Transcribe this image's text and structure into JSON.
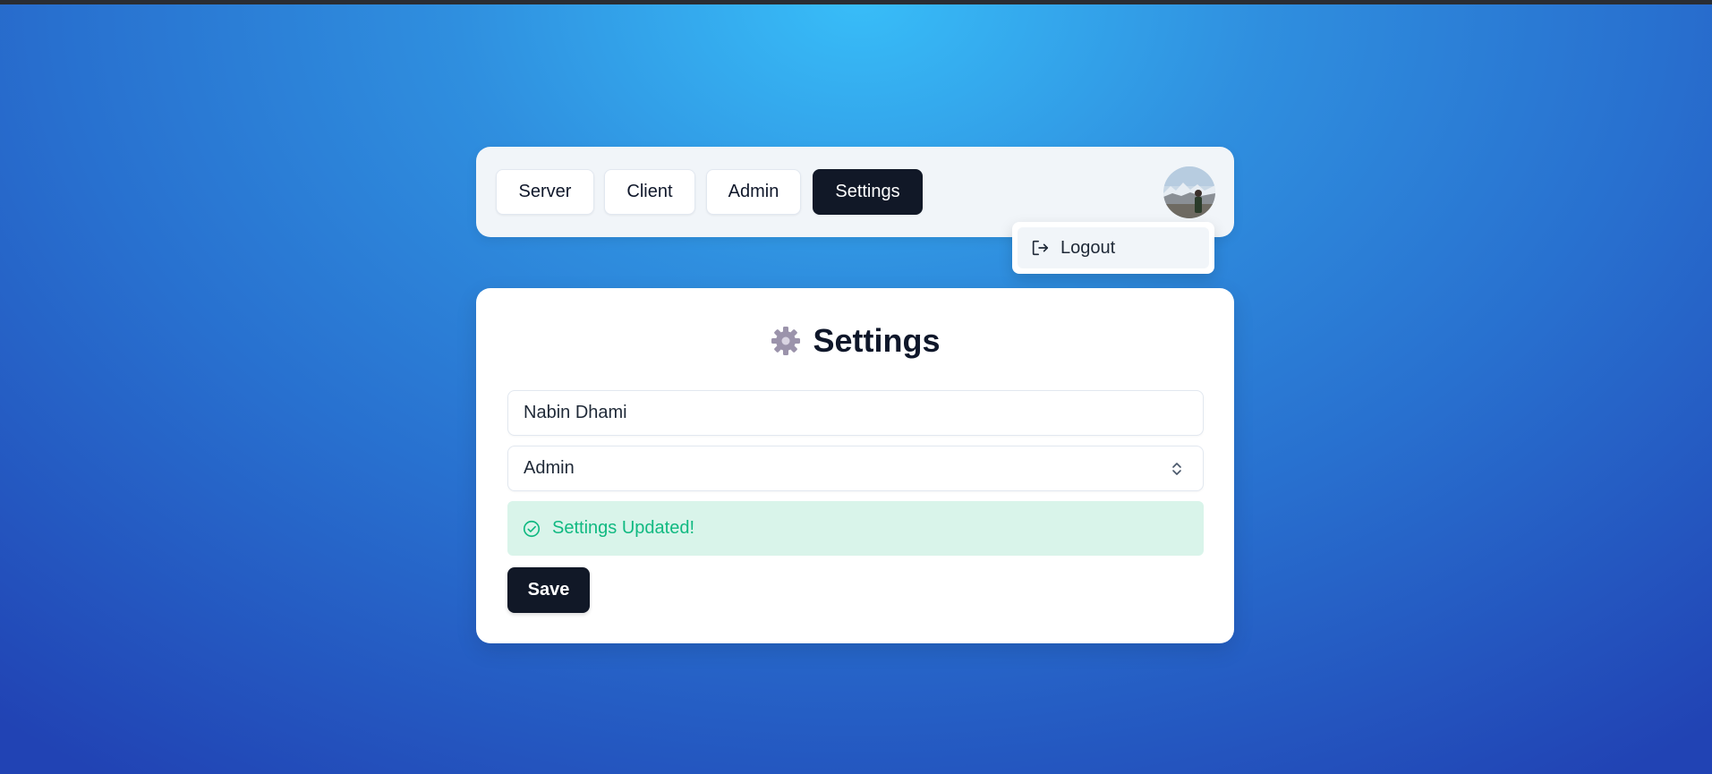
{
  "nav": {
    "items": [
      {
        "label": "Server",
        "active": false
      },
      {
        "label": "Client",
        "active": false
      },
      {
        "label": "Admin",
        "active": false
      },
      {
        "label": "Settings",
        "active": true
      }
    ],
    "avatar_alt": "User avatar"
  },
  "dropdown": {
    "logout_label": "Logout",
    "logout_icon": "logout-icon"
  },
  "settings": {
    "title": "Settings",
    "title_icon": "gear-icon",
    "name_value": "Nabin Dhami",
    "role_value": "Admin",
    "alert_text": "Settings Updated!",
    "alert_icon": "check-circle-icon",
    "save_label": "Save"
  },
  "colors": {
    "primary_dark": "#111827",
    "success_text": "#10b981",
    "success_bg": "#d9f4ea",
    "panel_bg": "#f1f5f9",
    "gear": "#9b93ab"
  }
}
